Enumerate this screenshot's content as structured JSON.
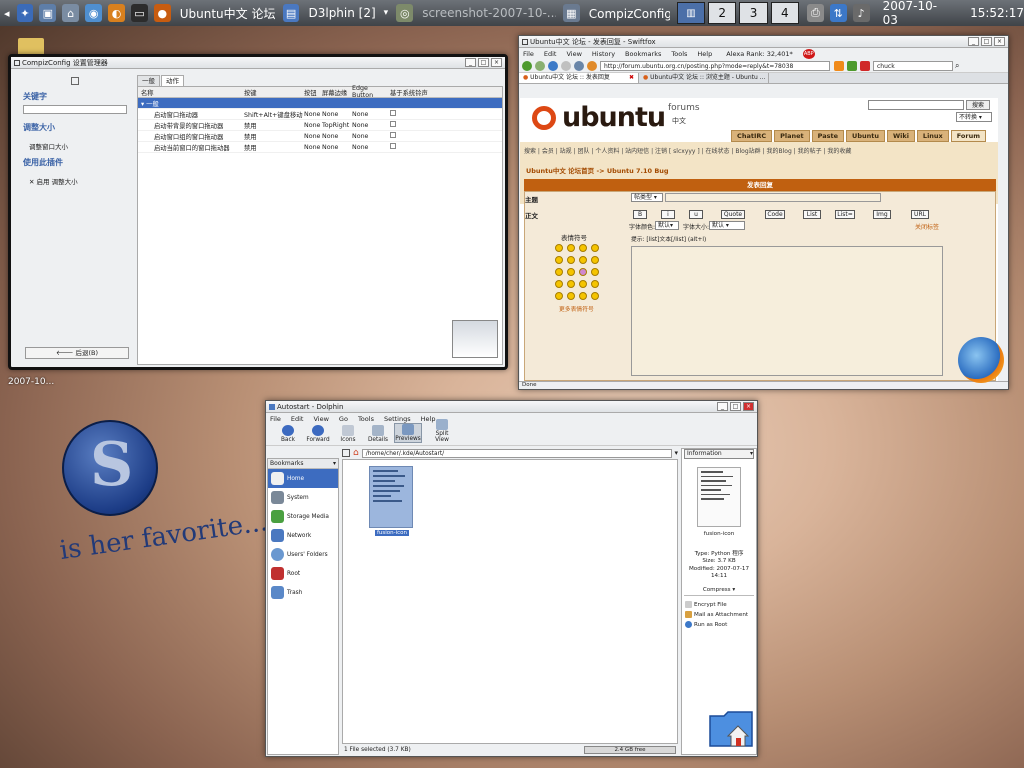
{
  "panel": {
    "tasks": [
      {
        "label": "Ubuntu中文 论坛",
        "active": false
      },
      {
        "label": "D3lphin [2]",
        "active": false
      },
      {
        "label": "screenshot-2007-10-...",
        "active": false
      },
      {
        "label": "CompizConfig 设置管...",
        "active": false
      }
    ],
    "pager": [
      "1",
      "2",
      "3",
      "4"
    ],
    "date": "2007-10-03",
    "time": "15:52:17"
  },
  "desktop": {
    "icon_label": "2007-10...",
    "logo_letter": "S",
    "tagline": "is her favorite..."
  },
  "compiz": {
    "title": "CompizConfig 设置管理器",
    "keyword_label": "关键字",
    "section_label": "调整大小",
    "section_item": "调整窗口大小",
    "plugin_label": "使用此插件",
    "plugin_item": "启用 调整大小",
    "back_button": "后退(B)",
    "tabs": [
      "一般",
      "动作"
    ],
    "columns": [
      "名称",
      "按键",
      "按钮",
      "屏幕边缘",
      "Edge Button",
      "基于系统铃声"
    ],
    "group": "一般",
    "rows": [
      {
        "name": "启动窗口拖动器",
        "key": "Shift+Alt+键盘移动",
        "button": "None",
        "edge": "None",
        "edge_button": "None"
      },
      {
        "name": "启动带背景的窗口拖动器",
        "key": "禁用",
        "button": "None",
        "edge": "TopRight",
        "edge_button": "None"
      },
      {
        "name": "启动窗口组的窗口拖动器",
        "key": "禁用",
        "button": "None",
        "edge": "None",
        "edge_button": "None"
      },
      {
        "name": "启动当前窗口的窗口拖动器",
        "key": "禁用",
        "button": "None",
        "edge": "None",
        "edge_button": "None"
      }
    ]
  },
  "fox": {
    "title": "Ubuntu中文 论坛 - 发表回复 - Swiftfox",
    "menus": [
      "File",
      "Edit",
      "View",
      "History",
      "Bookmarks",
      "Tools",
      "Help"
    ],
    "alexa": "Alexa Rank: 32,401*",
    "url": "http://forum.ubuntu.org.cn/posting.php?mode=reply&t=78038",
    "search": "chuck",
    "tabs": [
      "Ubuntu中文 论坛 :: 发表回复",
      "Ubuntu中文 论坛 :: 浏览主题 - Ubuntu ..."
    ],
    "logo": "ubuntu",
    "logo_sub": "forums",
    "logo_zh": "中文",
    "search_btn": "搜索",
    "lang_select": "不转换",
    "nav_tabs": [
      "ChatIRC",
      "Planet",
      "Paste",
      "Ubuntu",
      "Wiki",
      "Linux",
      "Forum"
    ],
    "links": "搜索 | 会员 | 站规 | 团队 | 个人资料 | 站内短信 | 注销 [ slcxyyy ] | 在线状态 | Blog站群 | 我的Blog | 我的帖子 | 我的收藏",
    "breadcrumb": "Ubuntu中文 论坛首页 -> Ubuntu 7.10 Bug",
    "form_header": "发表回复",
    "subject_label": "主题",
    "body_label": "正文",
    "prefix_select": "帖类型",
    "smilies_label": "表情符号",
    "more_smilies": "更多表情符号",
    "format_buttons": [
      "B",
      "i",
      "u",
      "Quote",
      "Code",
      "List",
      "List=",
      "Img",
      "URL"
    ],
    "font_color_label": "字体颜色:",
    "font_color_value": "默认",
    "font_size_label": "字体大小:",
    "font_size_value": "默认",
    "close_tags": "关闭标签",
    "tip": "提示: [list]文本[/list] (alt+l)",
    "status": "Done"
  },
  "dolphin": {
    "title": "Autostart - Dolphin",
    "menus": [
      "File",
      "Edit",
      "View",
      "Go",
      "Tools",
      "Settings",
      "Help"
    ],
    "toolbar": [
      "Back",
      "Forward",
      "Icons",
      "Details",
      "Previews",
      "Split View"
    ],
    "bookmarks_header": "Bookmarks",
    "bookmarks": [
      "Home",
      "System",
      "Storage Media",
      "Network",
      "Users' Folders",
      "Root",
      "Trash"
    ],
    "path": "/home/cher/.kde/Autostart/",
    "file_name": "fusion-icon",
    "info_header": "Information",
    "info_name": "fusion-icon",
    "info_type": "Type: Python 程序",
    "info_size": "Size: 3.7 KB",
    "info_modified": "Modified: 2007-07-17 14:11",
    "compress": "Compress",
    "actions": [
      "Encrypt File",
      "Mail as Attachment",
      "Run as Root"
    ],
    "status": "1 File selected (3.7 KB)",
    "free": "2.4 GB free"
  }
}
